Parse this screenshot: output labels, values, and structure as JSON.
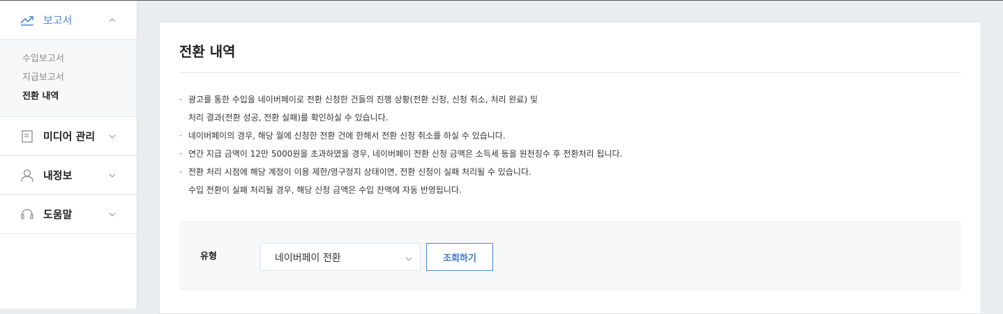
{
  "sidebar": {
    "report": {
      "label": "보고서",
      "icon": "trending-up-icon",
      "active_color": "#4a86d8",
      "items": [
        {
          "label": "수입보고서"
        },
        {
          "label": "지급보고서"
        },
        {
          "label": "전환 내역"
        }
      ]
    },
    "media": {
      "label": "미디어 관리",
      "icon": "document-icon"
    },
    "profile": {
      "label": "내정보",
      "icon": "user-icon"
    },
    "help": {
      "label": "도움말",
      "icon": "headset-icon"
    }
  },
  "main": {
    "title": "전환 내역",
    "notes": [
      {
        "line1": "광고를 통한 수입을 네이버페이로 전환 신청한 건들의 진행 상황(전환 신청, 신청 취소, 처리 완료) 및",
        "line2": "처리 결과(전환 성공, 전환 실패)를 확인하실 수 있습니다."
      },
      {
        "line1": "네이버페이의 경우, 해당 월에 신청한 전환 건에 한해서 전환 신청 취소를 하실 수 있습니다.",
        "line2": ""
      },
      {
        "line1": "연간 지급 금액이 12만 5000원을 초과하였을 경우, 네이버페이 전환 신청 금액은 소득세 등을 원천징수 후 전환처리 됩니다.",
        "line2": ""
      },
      {
        "line1": "전환 처리 시점에 해당 계정이 이용 제한/영구정지 상태이면, 전환 신청이 실패 처리될 수 있습니다.",
        "line2": "수입 전환이 실패 처리될 경우, 해당 신청 금액은 수입 잔액에 자동 반영됩니다."
      }
    ],
    "filter": {
      "type_label": "유형",
      "type_value": "네이버페이 전환",
      "search_button": "조회하기"
    }
  },
  "colors": {
    "accent": "#4a86d8",
    "background": "#e9ecf0"
  }
}
